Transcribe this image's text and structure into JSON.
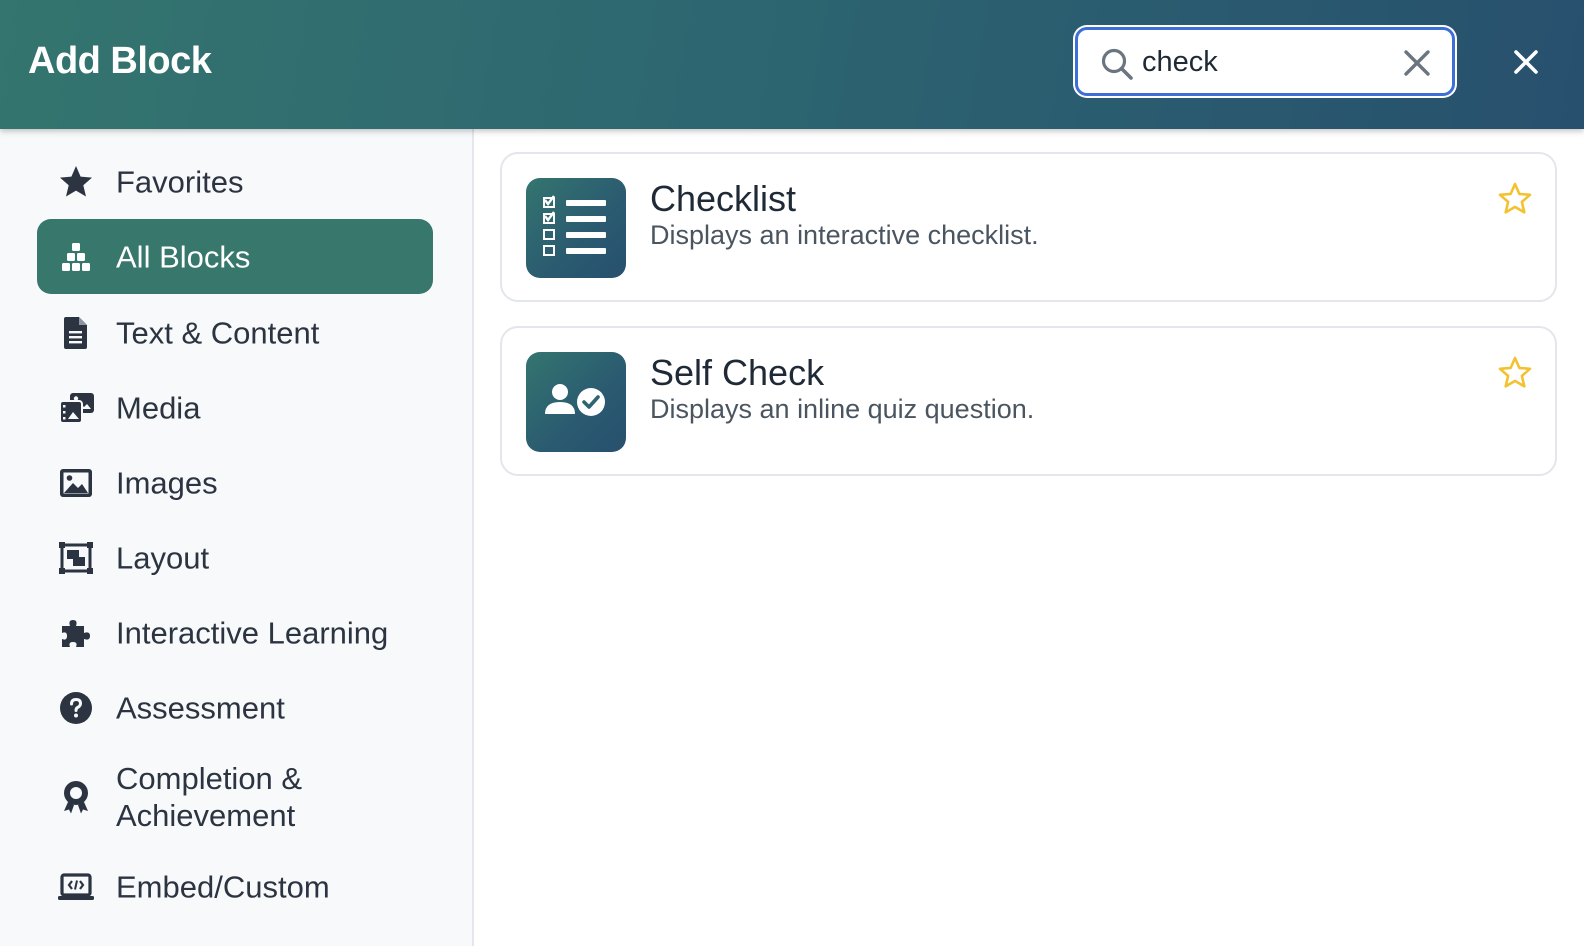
{
  "header": {
    "title": "Add Block",
    "search": {
      "value": "check",
      "placeholder": ""
    }
  },
  "sidebar": {
    "items": [
      {
        "label": "Favorites",
        "icon": "star-icon",
        "active": false
      },
      {
        "label": "All Blocks",
        "icon": "blocks-icon",
        "active": true
      },
      {
        "label": "Text & Content",
        "icon": "document-icon",
        "active": false
      },
      {
        "label": "Media",
        "icon": "media-icon",
        "active": false
      },
      {
        "label": "Images",
        "icon": "image-icon",
        "active": false
      },
      {
        "label": "Layout",
        "icon": "layout-icon",
        "active": false
      },
      {
        "label": "Interactive Learning",
        "icon": "puzzle-icon",
        "active": false
      },
      {
        "label": "Assessment",
        "icon": "question-icon",
        "active": false
      },
      {
        "label": "Completion & Achievement",
        "icon": "award-icon",
        "active": false
      },
      {
        "label": "Embed/Custom",
        "icon": "code-laptop-icon",
        "active": false
      }
    ]
  },
  "results": [
    {
      "title": "Checklist",
      "description": "Displays an interactive checklist.",
      "icon": "checklist-icon",
      "favorite": false
    },
    {
      "title": "Self Check",
      "description": "Displays an inline quiz question.",
      "icon": "user-check-icon",
      "favorite": false
    }
  ],
  "colors": {
    "header_start": "#34756f",
    "header_end": "#27506e",
    "active_item": "#37776c",
    "search_border": "#3d6fd6",
    "star": "#f2c230"
  }
}
